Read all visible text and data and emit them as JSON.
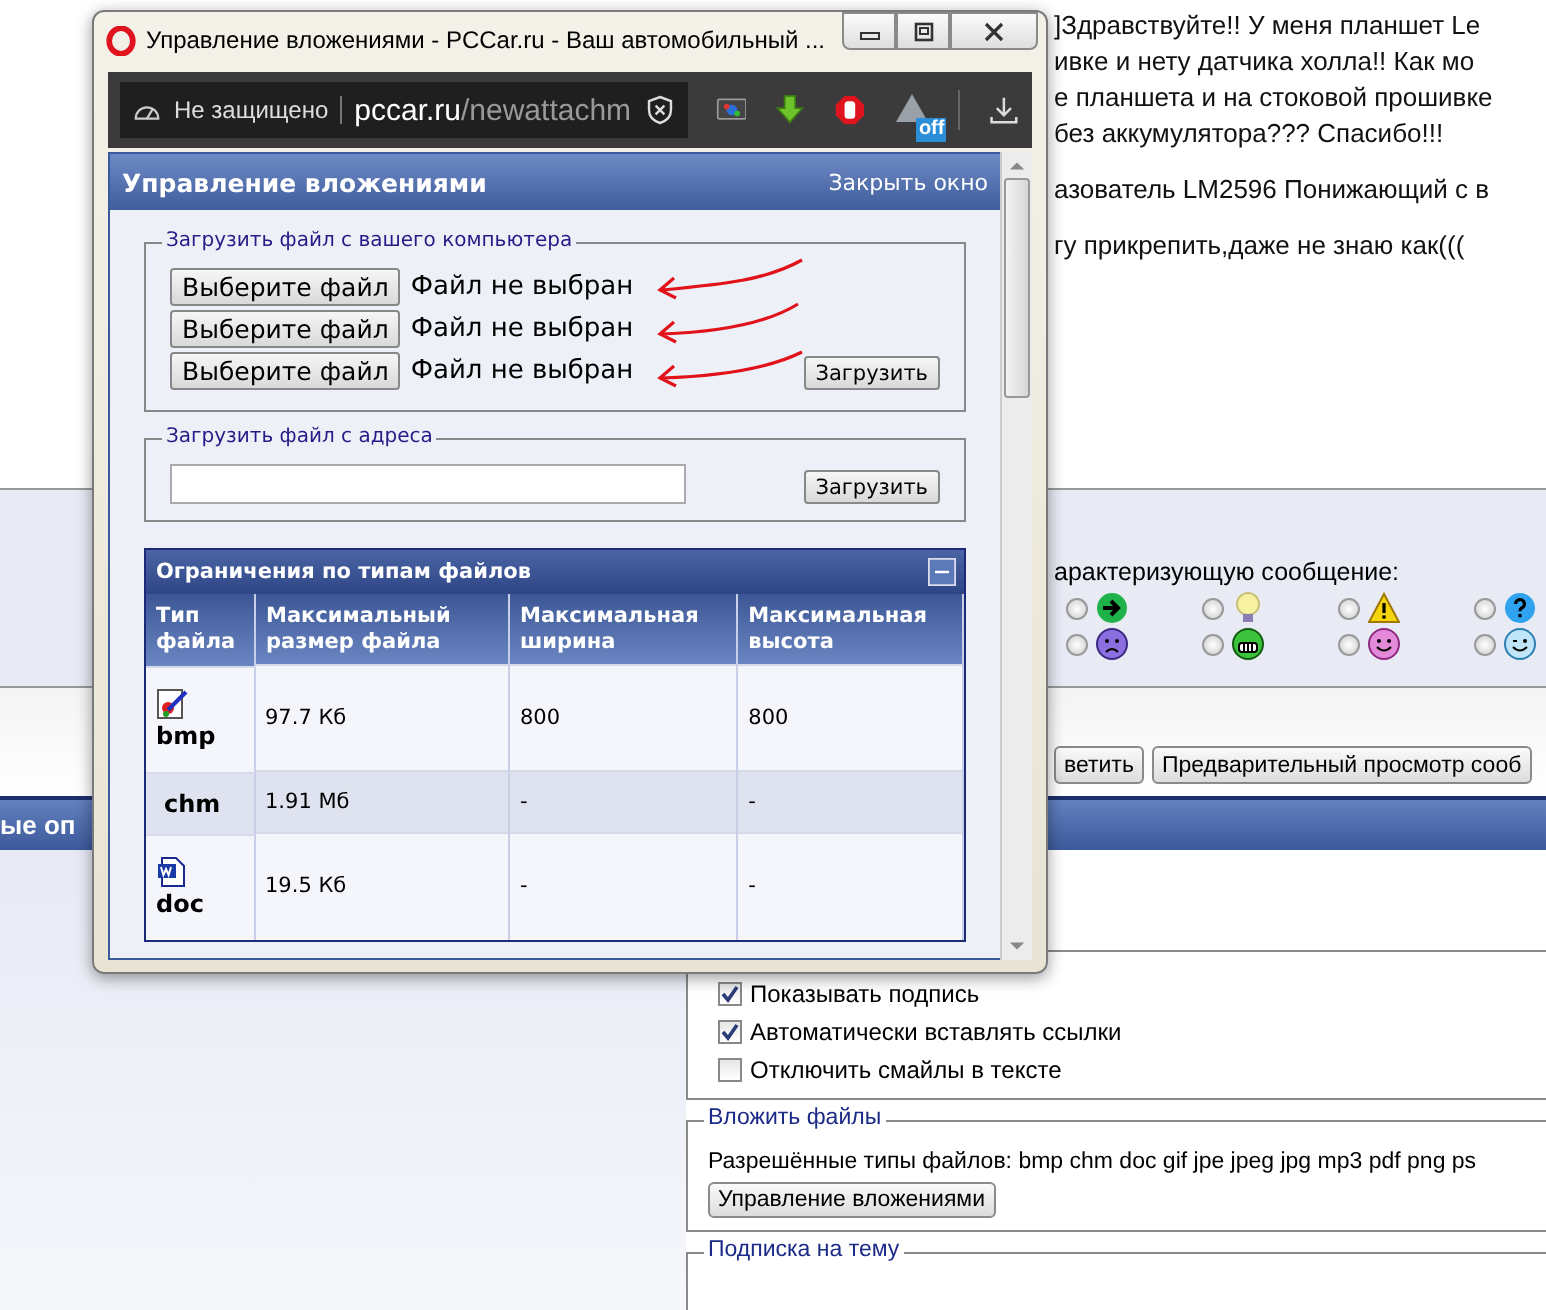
{
  "background_page": {
    "post_paragraphs": [
      [
        "]Здравствуйте!! У меня планшет Le",
        "ивке и нету датчика холла!! Как мо",
        "е планшета и на стоковой прошивке",
        "без аккумулятора??? Спасибо!!!"
      ],
      [
        "азователь LM2596 Понижающий с в"
      ],
      [
        "гу прикрепить,даже не знаю как((("
      ]
    ],
    "icon_prompt": "арактеризующую сообщение:",
    "icons": [
      {
        "kind": "arrow",
        "selected": false
      },
      {
        "kind": "bulb",
        "selected": false
      },
      {
        "kind": "warning",
        "selected": false
      },
      {
        "kind": "question",
        "selected": false
      },
      {
        "kind": "sad",
        "selected": false
      },
      {
        "kind": "grin",
        "selected": false
      },
      {
        "kind": "smile",
        "selected": false
      },
      {
        "kind": "wink",
        "selected": false
      }
    ],
    "buttons": [
      "ветить",
      "Предварительный просмотр сооб"
    ],
    "section_header": "ые оп",
    "options": [
      {
        "label": "Показывать подпись",
        "checked": true
      },
      {
        "label": "Автоматически вставлять ссылки",
        "checked": true
      },
      {
        "label": "Отключить смайлы в тексте",
        "checked": false
      }
    ],
    "attach": {
      "legend": "Вложить файлы",
      "allowed": "Разрешённые типы файлов: bmp chm doc gif jpe jpeg jpg mp3 pdf png ps",
      "button": "Управление вложениями"
    },
    "subscribe_legend": "Подписка на тему"
  },
  "popup": {
    "title": "Управление вложениями - PCCar.ru - Ваш автомобильный ...",
    "security": "Не защищено",
    "url_host": "pccar.ru",
    "url_path": "/newattachm",
    "extension_badge": "off",
    "header": "Управление вложениями",
    "close_link": "Закрыть окно",
    "local_upload": {
      "legend": "Загрузить файл с вашего компьютера",
      "inputs": [
        {
          "button": "Выберите файл",
          "status": "Файл не выбран"
        },
        {
          "button": "Выберите файл",
          "status": "Файл не выбран"
        },
        {
          "button": "Выберите файл",
          "status": "Файл не выбран"
        }
      ],
      "submit": "Загрузить"
    },
    "url_upload": {
      "legend": "Загрузить файл с адреса",
      "submit": "Загрузить"
    },
    "limits": {
      "title": "Ограничения по типам файлов",
      "expanded": true,
      "columns": [
        "Тип файла",
        "Максимальный размер файла",
        "Максимальная ширина",
        "Максимальная высота"
      ],
      "rows": [
        {
          "kind": "image",
          "cells": [
            "bmp",
            "97.7 Кб",
            "800",
            "800"
          ]
        },
        {
          "kind": "plain",
          "cells": [
            "chm",
            "1.91 Мб",
            "-",
            "-"
          ]
        },
        {
          "kind": "document",
          "cells": [
            "doc",
            "19.5 Кб",
            "-",
            "-"
          ]
        }
      ]
    }
  }
}
